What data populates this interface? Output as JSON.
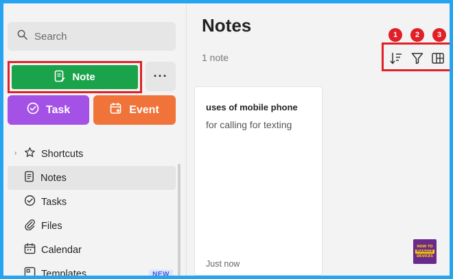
{
  "search": {
    "placeholder": "Search"
  },
  "actions": {
    "note_label": "Note",
    "more_label": "···",
    "task_label": "Task",
    "event_label": "Event"
  },
  "sidebar": {
    "items": [
      {
        "label": "Shortcuts",
        "icon": "star-icon",
        "expandable": true
      },
      {
        "label": "Notes",
        "icon": "note-icon",
        "active": true
      },
      {
        "label": "Tasks",
        "icon": "check-circle-icon"
      },
      {
        "label": "Files",
        "icon": "paperclip-icon"
      },
      {
        "label": "Calendar",
        "icon": "calendar-icon"
      },
      {
        "label": "Templates",
        "icon": "template-icon",
        "badge": "NEW"
      }
    ]
  },
  "main": {
    "title": "Notes",
    "count": "1 note",
    "toolbar": {
      "badges": [
        "1",
        "2",
        "3"
      ],
      "tools": [
        "sort-icon",
        "filter-icon",
        "view-grid-icon"
      ]
    },
    "notes": [
      {
        "title": "uses of mobile phone",
        "body": "for calling for texting",
        "time": "Just now"
      }
    ]
  },
  "watermark": {
    "line1": "HOW TO",
    "line2": "MANAGE",
    "line3": "DEVICES"
  },
  "colors": {
    "frame": "#27a4f0",
    "note_green": "#1aa34a",
    "task_purple": "#a452e6",
    "event_orange": "#f0733a",
    "highlight_red": "#e01f26"
  }
}
